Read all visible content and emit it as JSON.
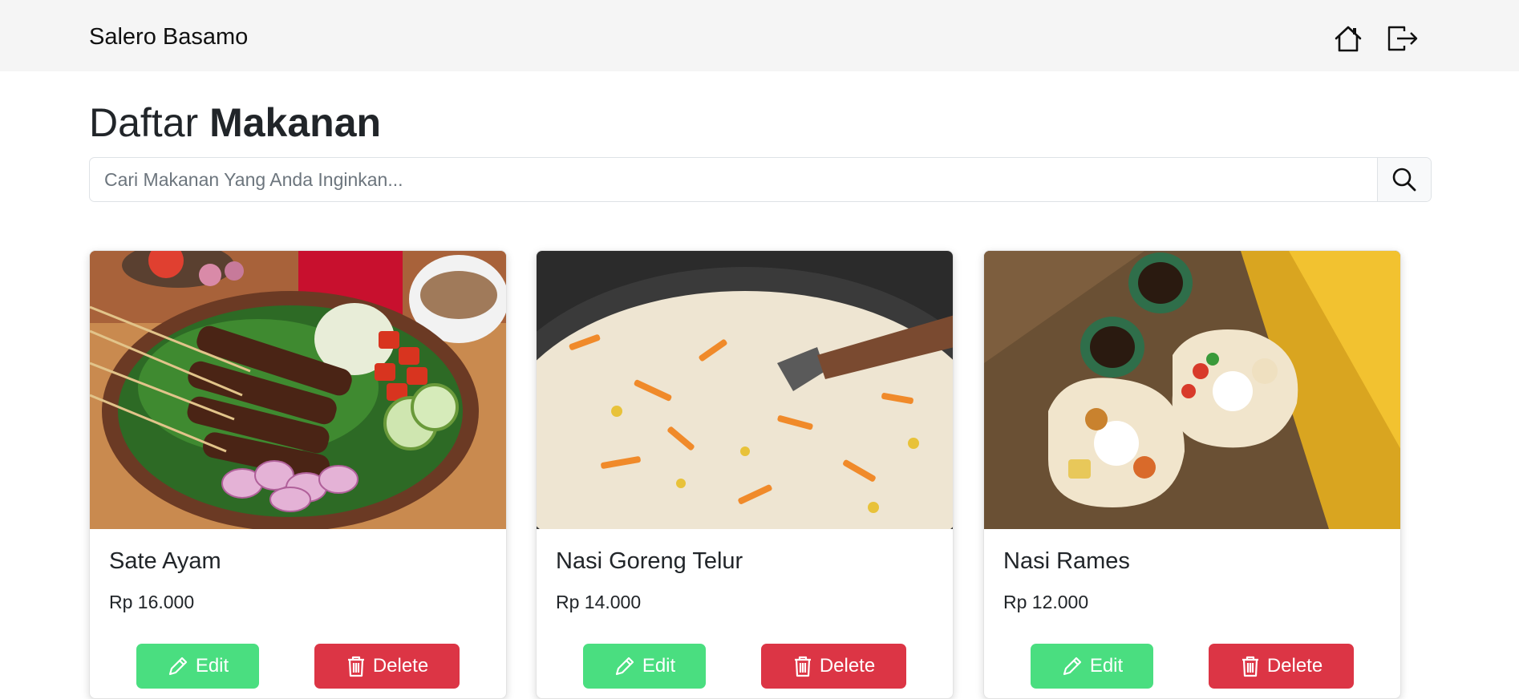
{
  "navbar": {
    "brand": "Salero Basamo",
    "icons": [
      "home-icon",
      "logout-icon"
    ]
  },
  "page": {
    "title_light": "Daftar",
    "title_bold": "Makanan"
  },
  "search": {
    "placeholder": "Cari Makanan Yang Anda Inginkan...",
    "value": "",
    "icon": "search-icon"
  },
  "foods": [
    {
      "name": "Sate Ayam",
      "price": "Rp 16.000",
      "edit_label": "Edit",
      "delete_label": "Delete"
    },
    {
      "name": "Nasi Goreng Telur",
      "price": "Rp 14.000",
      "edit_label": "Edit",
      "delete_label": "Delete"
    },
    {
      "name": "Nasi Rames",
      "price": "Rp 12.000",
      "edit_label": "Edit",
      "delete_label": "Delete"
    }
  ],
  "colors": {
    "navbar_bg": "#f5f5f5",
    "edit_button": "#4ade80",
    "delete_button": "#dc3545"
  }
}
